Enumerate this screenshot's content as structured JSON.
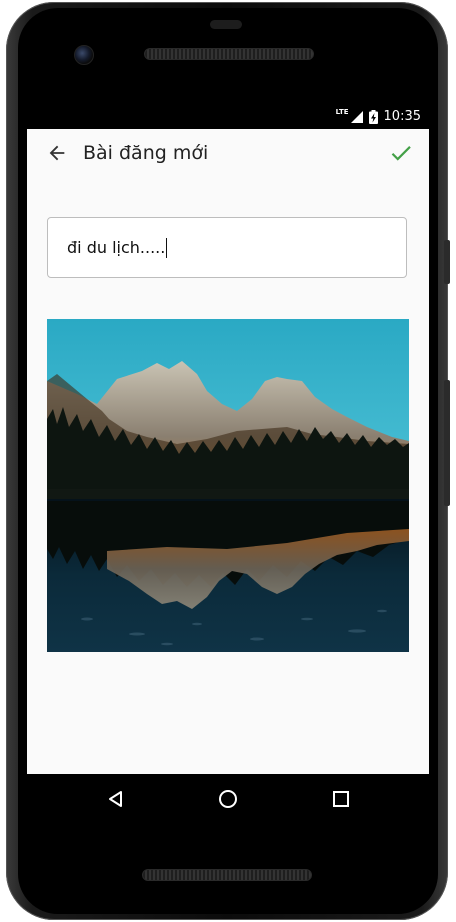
{
  "status_bar": {
    "network": "LTE",
    "time": "10:35"
  },
  "app_bar": {
    "title": "Bài đăng mới",
    "accent_color": "#43a047"
  },
  "post": {
    "text_value": "đi du lịch.....",
    "image_description": "mountain-lake-reflection-photo"
  },
  "navigation": {
    "buttons": [
      "back",
      "home",
      "recents"
    ]
  }
}
